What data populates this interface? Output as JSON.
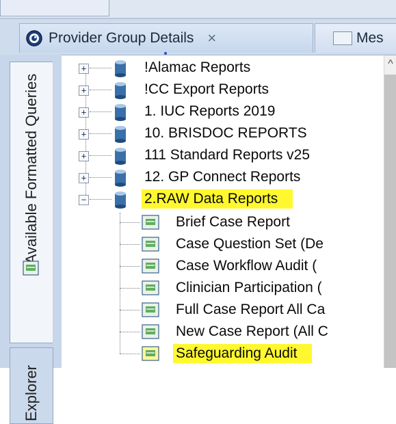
{
  "tabs": {
    "provider": {
      "label": "Provider Group Details",
      "close": "×"
    },
    "mes": {
      "label": "Mes"
    }
  },
  "side_panel": {
    "queries_label": "Available Formatted Queries",
    "explorer_label": "Explorer"
  },
  "tree": {
    "folders": [
      {
        "label": "!Alamac Reports",
        "expander": "+"
      },
      {
        "label": "!CC Export Reports",
        "expander": "+"
      },
      {
        "label": "1. IUC Reports 2019",
        "expander": "+"
      },
      {
        "label": "10. BRISDOC REPORTS",
        "expander": "+"
      },
      {
        "label": "111 Standard Reports v25",
        "expander": "+"
      },
      {
        "label": "12. GP Connect Reports",
        "expander": "+"
      },
      {
        "label": "2.RAW Data Reports",
        "expander": "−",
        "highlighted": true
      }
    ],
    "reports": [
      {
        "label": "Brief Case Report"
      },
      {
        "label": "Case Question Set (De"
      },
      {
        "label": "Case Workflow Audit ("
      },
      {
        "label": "Clinician Participation ("
      },
      {
        "label": "Full Case Report All Ca"
      },
      {
        "label": "New Case Report (All C"
      },
      {
        "label": "Safeguarding Audit",
        "highlighted": true
      }
    ]
  },
  "scrollbar": {
    "up_arrow": "^"
  },
  "colors": {
    "highlight": "#fff82e",
    "panel": "#c7d6ea",
    "tabbar": "#cfdced"
  }
}
